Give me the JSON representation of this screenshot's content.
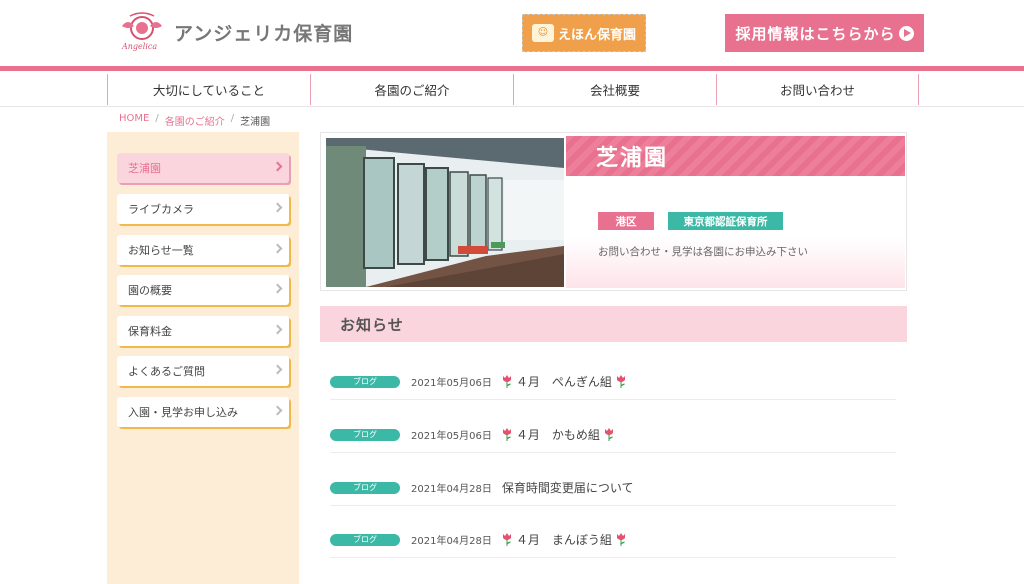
{
  "header": {
    "logo_text": "アンジェリカ保育園",
    "logo_script": "Angelica",
    "ehon_label": "えほん保育園",
    "recruit_label": "採用情報はこちらから"
  },
  "nav": {
    "items": [
      {
        "label": "大切にしていること"
      },
      {
        "label": "各園のご紹介"
      },
      {
        "label": "会社概要"
      },
      {
        "label": "お問い合わせ"
      }
    ]
  },
  "breadcrumb": {
    "home": "HOME",
    "sep": "/",
    "parent": "各園のご紹介",
    "current": "芝浦園"
  },
  "sidebar": {
    "items": [
      {
        "label": "芝浦園"
      },
      {
        "label": "ライブカメラ"
      },
      {
        "label": "お知らせ一覧"
      },
      {
        "label": "園の概要"
      },
      {
        "label": "保育料金"
      },
      {
        "label": "よくあるご質問"
      },
      {
        "label": "入園・見学お申し込み"
      }
    ]
  },
  "hero": {
    "title": "芝浦園",
    "tag_area": "港区",
    "tag_cert": "東京都認証保育所",
    "note": "お問い合わせ・見学は各園にお申込み下さい"
  },
  "news": {
    "heading": "お知らせ",
    "items": [
      {
        "badge": "ブログ",
        "date": "2021年05月06日",
        "title": "４月　ぺんぎん組",
        "tulips": true
      },
      {
        "badge": "ブログ",
        "date": "2021年05月06日",
        "title": "４月　かもめ組",
        "tulips": true
      },
      {
        "badge": "ブログ",
        "date": "2021年04月28日",
        "title": "保育時間変更届について",
        "tulips": false
      },
      {
        "badge": "ブログ",
        "date": "2021年04月28日",
        "title": "４月　まんぼう組",
        "tulips": true
      }
    ]
  },
  "colors": {
    "brand_pink": "#e8718f",
    "light_pink": "#fbd5de",
    "teal": "#3bb9a6",
    "sidebar_bg": "#fdecd6",
    "ehon_orange": "#f0a04a"
  }
}
